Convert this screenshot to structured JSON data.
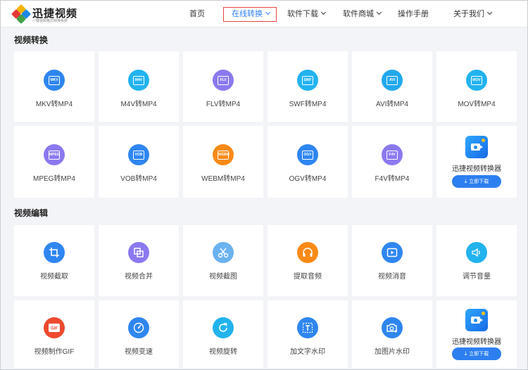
{
  "header": {
    "brand": "迅捷视频",
    "brand_sub": "一键视频格式转换免费",
    "nav": [
      {
        "label": "首页",
        "dropdown": false
      },
      {
        "label": "在线转换",
        "dropdown": true
      },
      {
        "label": "软件下载",
        "dropdown": true
      },
      {
        "label": "软件商城",
        "dropdown": true
      },
      {
        "label": "操作手册",
        "dropdown": false
      },
      {
        "label": "关于我们",
        "dropdown": true
      }
    ],
    "active_nav": "在线转换"
  },
  "convert": {
    "title": "视频转换",
    "items": [
      {
        "label": "MKV转MP4",
        "badge": "MKV",
        "color": "#2f86f0"
      },
      {
        "label": "M4V转MP4",
        "badge": "M4V",
        "color": "#22b3ee"
      },
      {
        "label": "FLV转MP4",
        "badge": "FLV",
        "color": "#8b79f0"
      },
      {
        "label": "SWF转MP4",
        "badge": "SWF",
        "color": "#22b3ee"
      },
      {
        "label": "AVI转MP4",
        "badge": "AVI",
        "color": "#22a8ee"
      },
      {
        "label": "MOV转MP4",
        "badge": "MOV",
        "color": "#22b3ee"
      },
      {
        "label": "MPEG转MP4",
        "badge": "MPEG",
        "color": "#8b79f0"
      },
      {
        "label": "VOB转MP4",
        "badge": "VOB",
        "color": "#2f86f0"
      },
      {
        "label": "WEBM转MP4",
        "badge": "WEBM",
        "color": "#f98a17"
      },
      {
        "label": "OGV转MP4",
        "badge": "OGV",
        "color": "#2f86f0"
      },
      {
        "label": "F4V转MP4",
        "badge": "F4V",
        "color": "#8b79f0"
      }
    ],
    "app": {
      "title": "迅捷视频转换器",
      "button": "立即下载"
    }
  },
  "edit": {
    "title": "视频编辑",
    "items": [
      {
        "label": "视频截取",
        "icon": "crop-icon",
        "color": "#2f86f0"
      },
      {
        "label": "视频合并",
        "icon": "merge-icon",
        "color": "#8b79f0"
      },
      {
        "label": "视频截图",
        "icon": "scissors-icon",
        "color": "#6ab2f0"
      },
      {
        "label": "提取音频",
        "icon": "headphones-icon",
        "color": "#f98a17"
      },
      {
        "label": "视频消音",
        "icon": "video-play-icon",
        "color": "#2f86f0"
      },
      {
        "label": "调节音量",
        "icon": "volume-icon",
        "color": "#22b3ee"
      },
      {
        "label": "视频制作GIF",
        "icon": "gif-icon",
        "color": "#ee4a2f"
      },
      {
        "label": "视频变速",
        "icon": "speed-gauge-icon",
        "color": "#2f86f0"
      },
      {
        "label": "视频旋转",
        "icon": "rotate-icon",
        "color": "#22b3ee"
      },
      {
        "label": "加文字水印",
        "icon": "text-watermark-icon",
        "color": "#2f86f0"
      },
      {
        "label": "加图片水印",
        "icon": "image-watermark-icon",
        "color": "#2f86f0"
      }
    ],
    "app": {
      "title": "迅捷视频转换器",
      "button": "立即下载"
    }
  }
}
